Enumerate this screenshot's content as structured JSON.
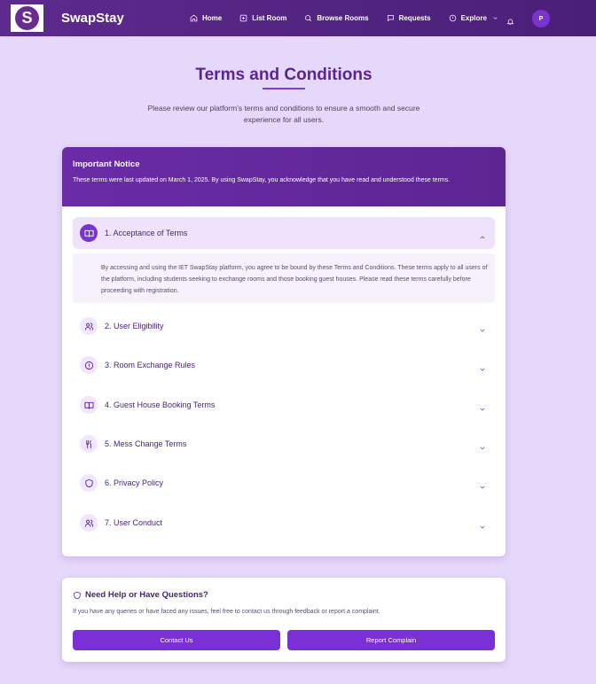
{
  "app": {
    "logo_letter": "S",
    "brand": "SwapStay"
  },
  "nav": {
    "items": [
      {
        "label": "Home",
        "icon": "home-icon"
      },
      {
        "label": "List Room",
        "icon": "plus-square-icon"
      },
      {
        "label": "Browse Rooms",
        "icon": "search-icon"
      },
      {
        "label": "Requests",
        "icon": "message-icon"
      },
      {
        "label": "Explore",
        "icon": "compass-icon"
      }
    ],
    "avatar_initial": "P"
  },
  "header": {
    "title": "Terms and Conditions",
    "subtitle": "Please review our platform's terms and conditions to ensure a smooth and secure experience for all users."
  },
  "notice": {
    "title": "Important Notice",
    "text": "These terms were last updated on March 1, 2025. By using SwapStay, you acknowledge that you have read and understood these terms."
  },
  "sections": [
    {
      "label": "1. Acceptance of Terms",
      "icon": "book-open-icon",
      "open": true,
      "body": "By accessing and using the IET SwapStay platform, you agree to be bound by these Terms and Conditions. These terms apply to all users of the platform, including students seeking to exchange rooms and those booking guest houses. Please read these terms carefully before proceeding with registration."
    },
    {
      "label": "2. User Eligibility",
      "icon": "users-icon",
      "open": false
    },
    {
      "label": "3. Room Exchange Rules",
      "icon": "alert-circle-icon",
      "open": false
    },
    {
      "label": "4. Guest House Booking Terms",
      "icon": "book-open-icon",
      "open": false
    },
    {
      "label": "5. Mess Change Terms",
      "icon": "utensils-icon",
      "open": false
    },
    {
      "label": "6. Privacy Policy",
      "icon": "shield-icon",
      "open": false
    },
    {
      "label": "7. User Conduct",
      "icon": "users-icon",
      "open": false
    }
  ],
  "help": {
    "title": "Need Help or Have Questions?",
    "text": "If you have any queries or have faced any issues, feel free to contact us through feedback or report a complaint.",
    "contact_label": "Contact Us",
    "report_label": "Report Complain"
  },
  "colors": {
    "primary": "#6a2ca7",
    "button": "#7b2fd6",
    "background": "#e6d8fa"
  }
}
